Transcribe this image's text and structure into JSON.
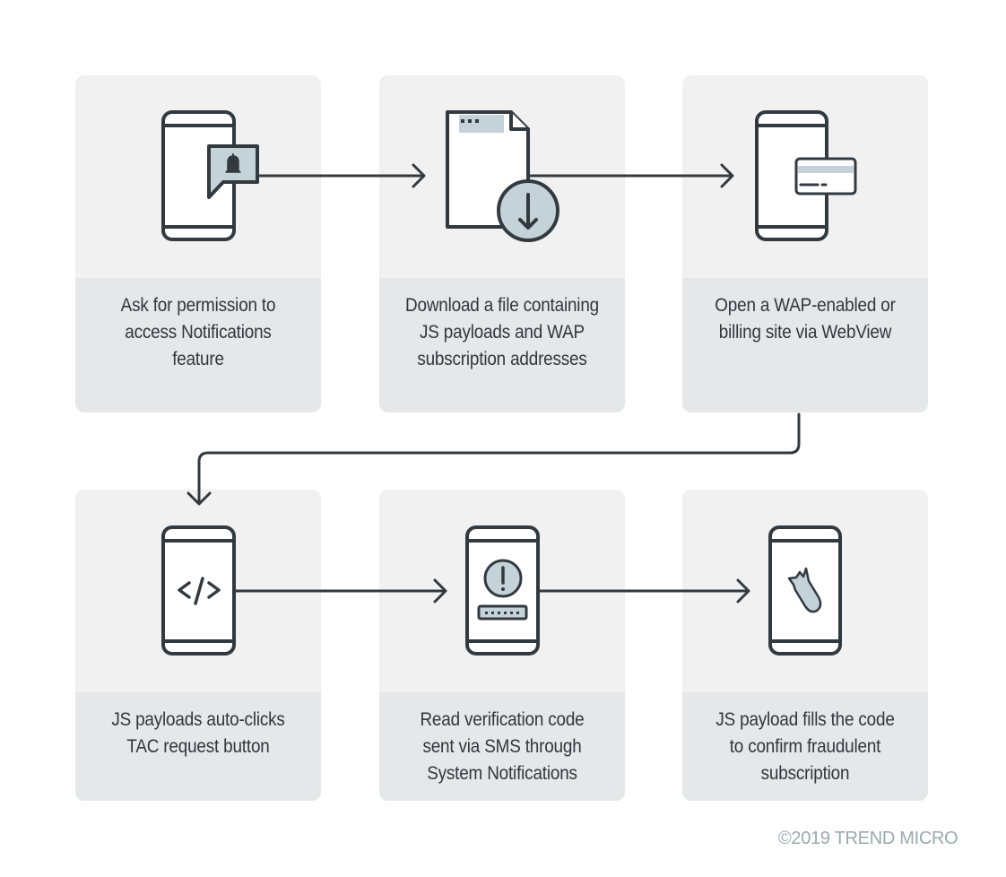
{
  "diagram": {
    "steps": [
      {
        "label": "Ask for permission to access Notifications feature",
        "icon": "phone-notification-bell-icon"
      },
      {
        "label": "Download a file containing JS payloads and WAP subscription addresses",
        "icon": "file-download-icon"
      },
      {
        "label": "Open a WAP-enabled or billing site via WebView",
        "icon": "phone-credit-card-icon"
      },
      {
        "label": "JS payloads auto-clicks TAC request button",
        "icon": "phone-code-icon"
      },
      {
        "label": "Read verification code sent via SMS through System Notifications",
        "icon": "phone-alert-code-icon"
      },
      {
        "label": "JS payload fills the code to confirm fraudulent subscription",
        "icon": "phone-bomb-icon"
      }
    ],
    "colors": {
      "stroke": "#333a3f",
      "accent_fill": "#c5d2d8",
      "card_top": "#f1f1f1",
      "card_bottom": "#e6e7e8",
      "copyright": "#9aa9ae"
    }
  },
  "footer": {
    "copyright": "©2019 TREND MICRO"
  }
}
